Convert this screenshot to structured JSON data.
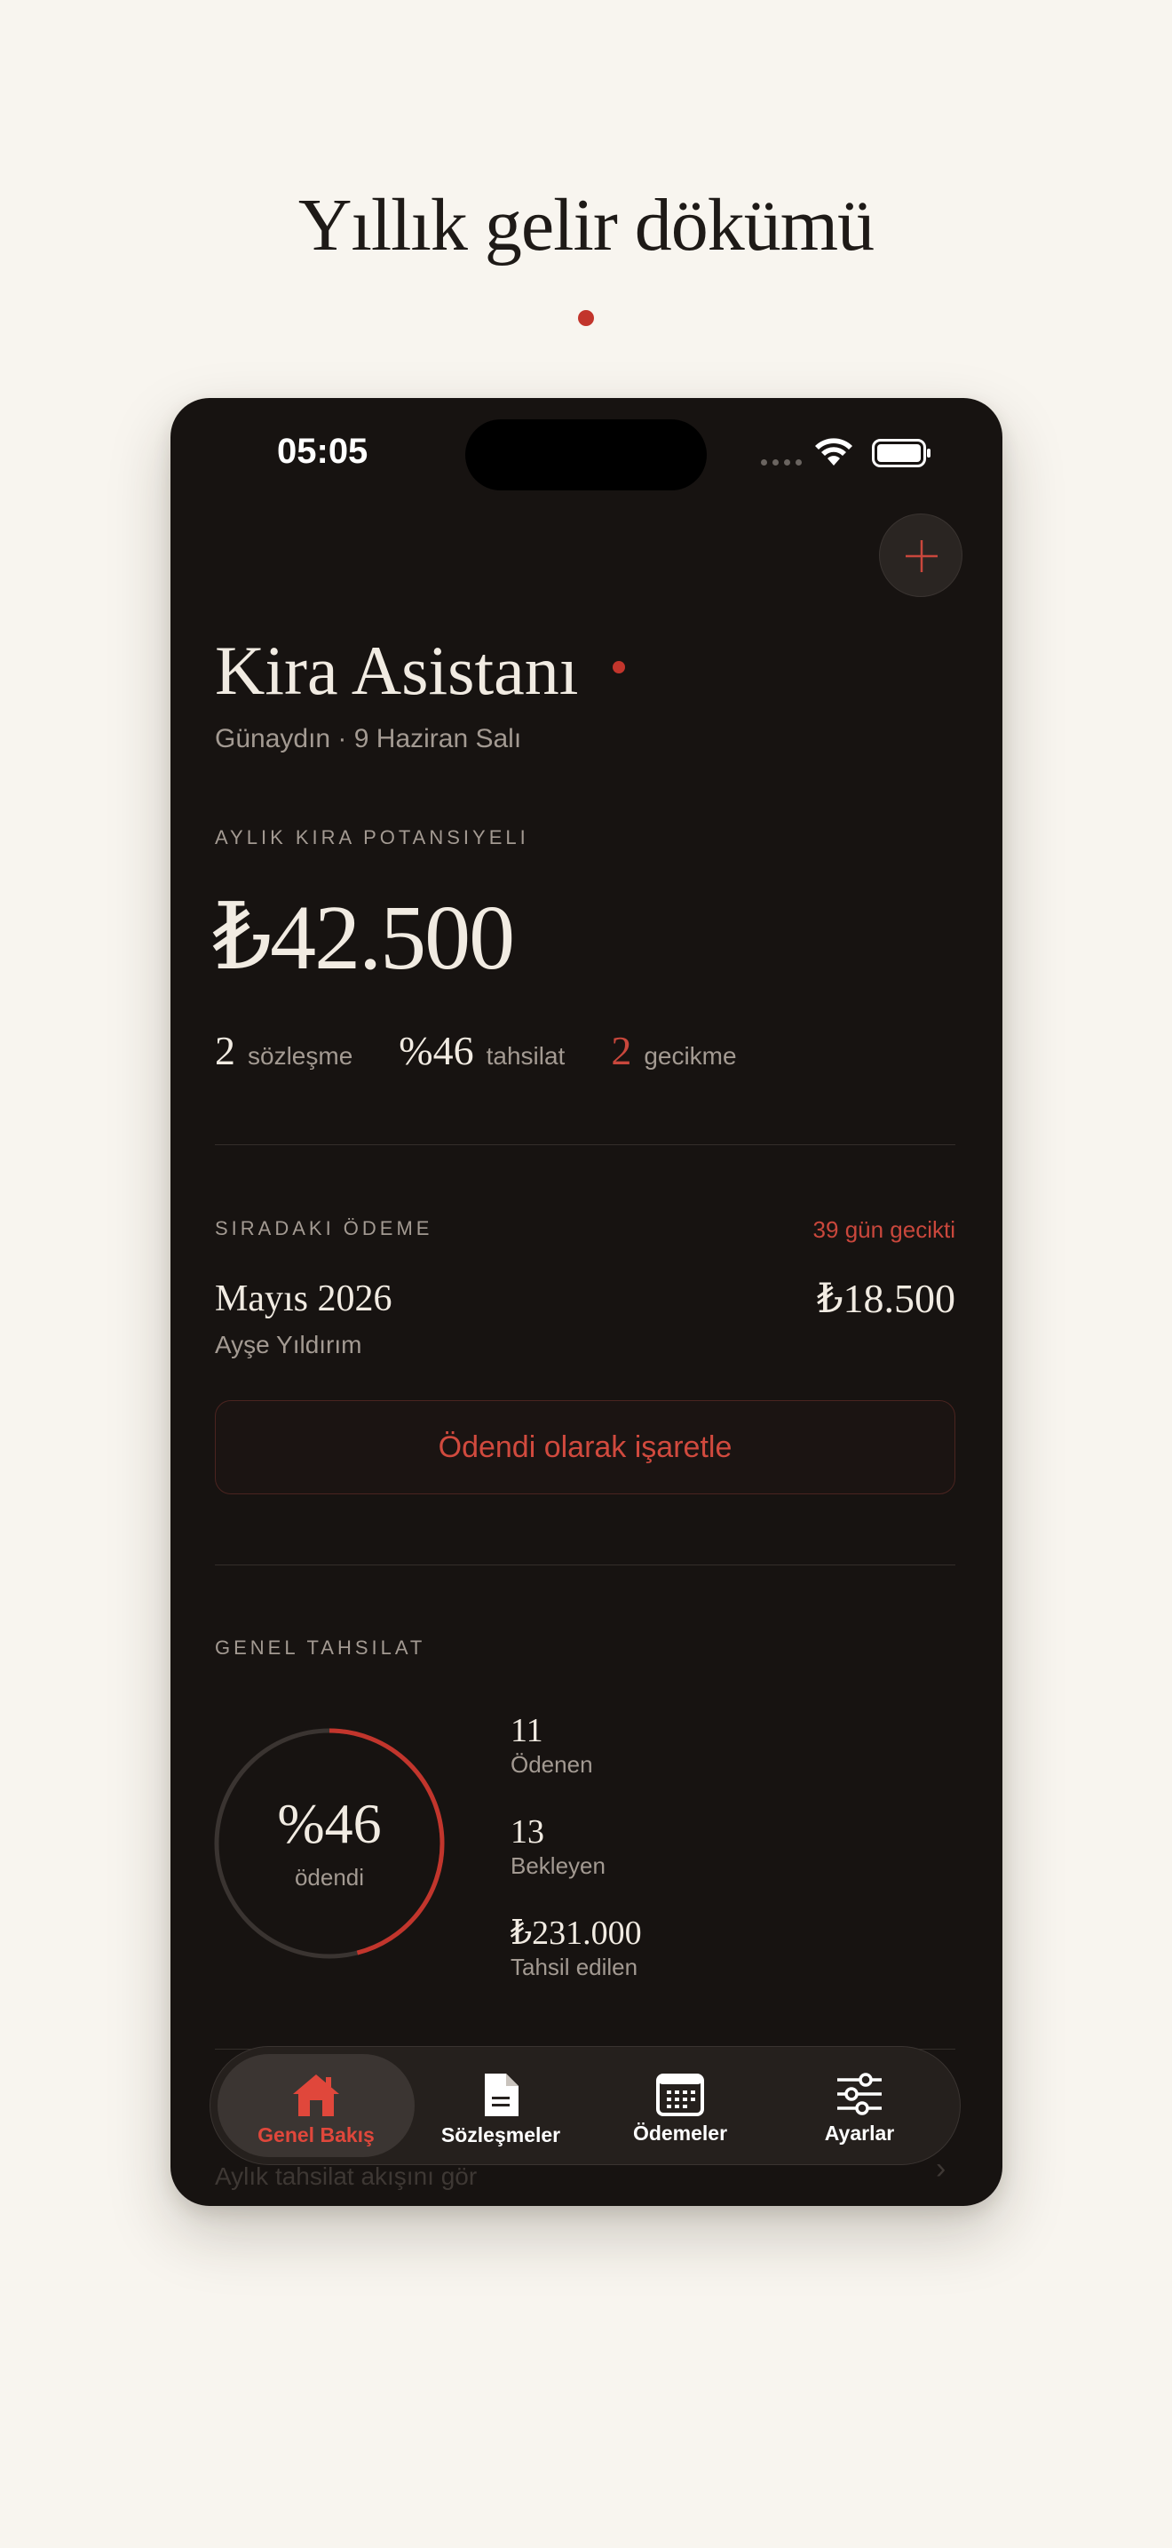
{
  "headline": "Yıllık gelir dökümü",
  "status_bar": {
    "time": "05:05"
  },
  "header": {
    "title": "Kira Asistanı",
    "subtitle": "Günaydın · 9 Haziran Salı"
  },
  "potential": {
    "eyebrow": "AYLIK KIRA POTANSIYELI",
    "amount": "₺42.500",
    "stats": [
      {
        "value": "2",
        "label": "sözleşme",
        "highlight": false
      },
      {
        "value": "%46",
        "label": "tahsilat",
        "highlight": false
      },
      {
        "value": "2",
        "label": "gecikme",
        "highlight": true
      }
    ]
  },
  "next_payment": {
    "eyebrow": "SIRADAKI ÖDEME",
    "status": "39 gün gecikti",
    "month": "Mayıs 2026",
    "amount": "₺18.500",
    "tenant": "Ayşe Yıldırım",
    "action_label": "Ödendi olarak işaretle"
  },
  "collection": {
    "eyebrow": "GENEL TAHSILAT",
    "percent_value": 0.46,
    "percent_text": "%46",
    "caption": "ödendi",
    "metrics": [
      {
        "value": "11",
        "label": "Ödenen"
      },
      {
        "value": "13",
        "label": "Bekleyen"
      },
      {
        "value": "₺231.000",
        "label": "Tahsil edilen"
      }
    ]
  },
  "hidden_row": {
    "label": "Aylık tahsilat akışını gör",
    "chevron": "›"
  },
  "tabbar": {
    "items": [
      {
        "label": "Genel Bakış",
        "icon": "house-icon",
        "active": true
      },
      {
        "label": "Sözleşmeler",
        "icon": "document-icon",
        "active": false
      },
      {
        "label": "Ödemeler",
        "icon": "calendar-icon",
        "active": false
      },
      {
        "label": "Ayarlar",
        "icon": "sliders-icon",
        "active": false
      }
    ]
  },
  "colors": {
    "accent": "#c9473c",
    "background": "#f8f5ef",
    "phone_background": "#171311",
    "text_primary": "#f1ebe2",
    "text_secondary": "#a39a92"
  }
}
